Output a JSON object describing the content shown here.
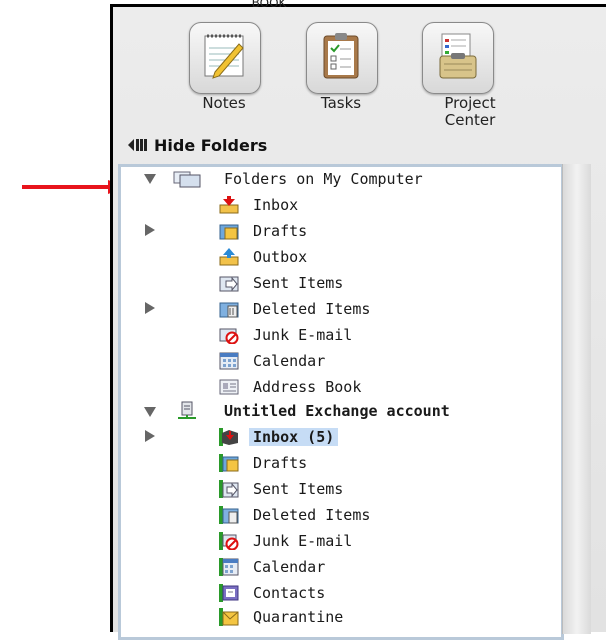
{
  "toolbar": {
    "book_label": "Book",
    "items": [
      {
        "label": "Notes",
        "icon": "notepad-icon"
      },
      {
        "label": "Tasks",
        "icon": "clipboard-icon"
      },
      {
        "label": "Project Center",
        "icon": "project-clipboard-icon"
      }
    ]
  },
  "hide_folders": {
    "label": "Hide Folders",
    "icon": "hide-panel-icon"
  },
  "tree": {
    "sections": [
      {
        "name": "Folders on My Computer",
        "icon": "computer-folders-icon",
        "expanded": true,
        "items": [
          {
            "label": "Inbox",
            "icon": "inbox-icon",
            "has_children": false
          },
          {
            "label": "Drafts",
            "icon": "drafts-icon",
            "has_children": true
          },
          {
            "label": "Outbox",
            "icon": "outbox-icon",
            "has_children": false
          },
          {
            "label": "Sent Items",
            "icon": "sent-items-icon",
            "has_children": false
          },
          {
            "label": "Deleted Items",
            "icon": "deleted-items-icon",
            "has_children": true
          },
          {
            "label": "Junk E-mail",
            "icon": "junk-mail-icon",
            "has_children": false
          },
          {
            "label": "Calendar",
            "icon": "calendar-icon",
            "has_children": false
          },
          {
            "label": "Address Book",
            "icon": "address-book-icon",
            "has_children": false
          }
        ]
      },
      {
        "name": "Untitled Exchange account",
        "icon": "exchange-server-icon",
        "expanded": true,
        "items": [
          {
            "label": "Inbox (5)",
            "icon": "exchange-inbox-icon",
            "has_children": true,
            "selected": true
          },
          {
            "label": "Drafts",
            "icon": "exchange-drafts-icon",
            "has_children": false
          },
          {
            "label": "Sent Items",
            "icon": "exchange-sent-icon",
            "has_children": false
          },
          {
            "label": "Deleted Items",
            "icon": "exchange-deleted-icon",
            "has_children": false
          },
          {
            "label": "Junk E-mail",
            "icon": "exchange-junk-icon",
            "has_children": false
          },
          {
            "label": "Calendar",
            "icon": "exchange-calendar-icon",
            "has_children": false
          },
          {
            "label": "Contacts",
            "icon": "exchange-contacts-icon",
            "has_children": false
          },
          {
            "label": "Quarantine",
            "icon": "exchange-quarantine-icon",
            "has_children": false
          }
        ]
      }
    ]
  },
  "colors": {
    "annotation_arrow": "#e8141c",
    "selection": "#c6dcf5",
    "tree_border": "#b9c9d9"
  }
}
